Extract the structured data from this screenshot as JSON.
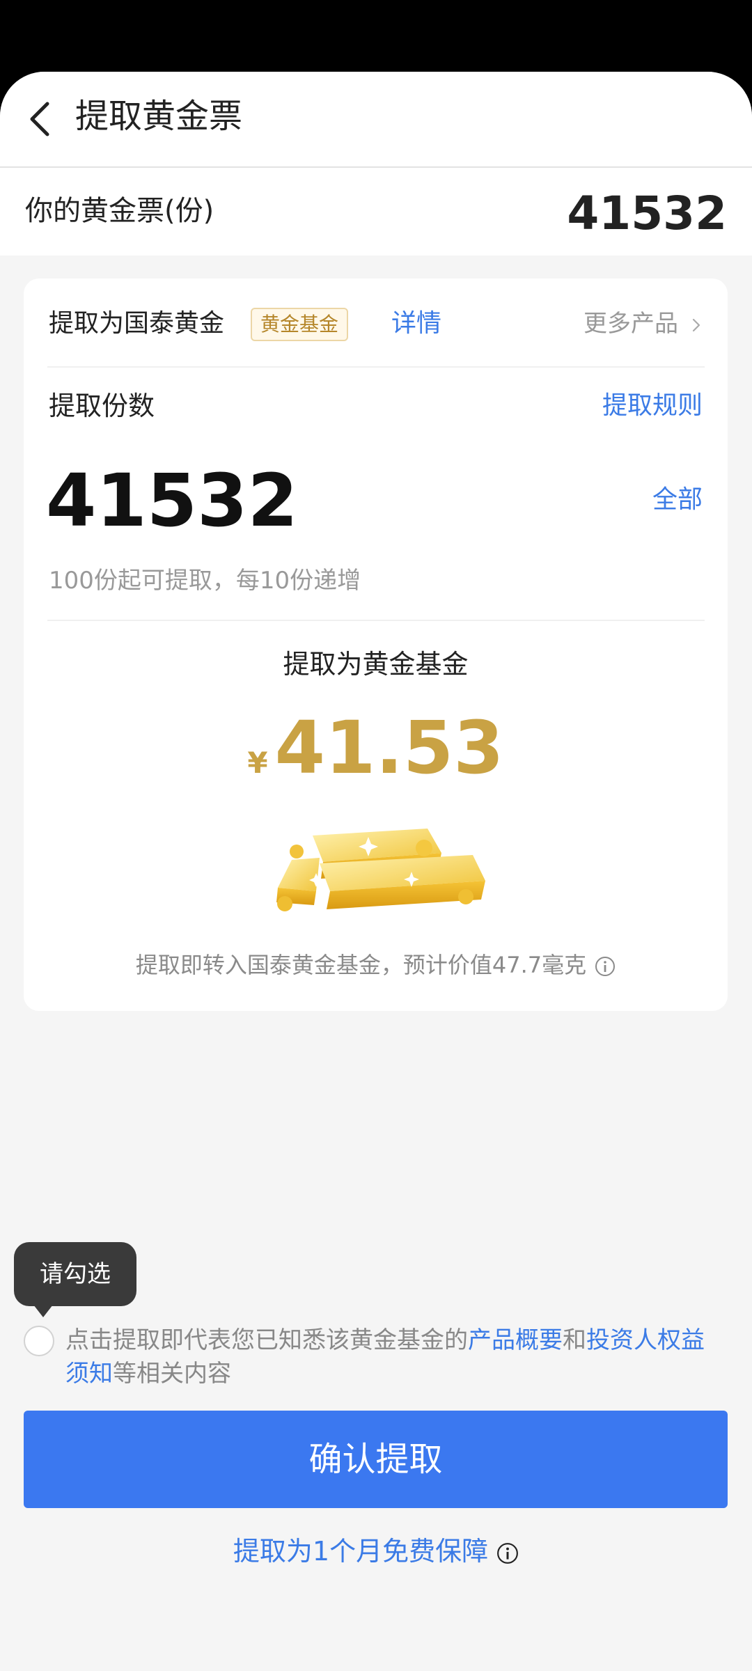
{
  "header": {
    "title": "提取黄金票",
    "back_icon": "chevron-left-icon"
  },
  "balance": {
    "label": "你的黄金票(份)",
    "value": "41532"
  },
  "product": {
    "prefix": "提取为国泰黄金",
    "badge": "黄金基金",
    "detail_link": "详情",
    "more_products": "更多产品"
  },
  "quantity": {
    "label": "提取份数",
    "rules_link": "提取规则",
    "value": "41532",
    "all_link": "全部",
    "hint": "100份起可提取，每10份递增"
  },
  "result": {
    "title": "提取为黄金基金",
    "currency": "¥",
    "amount": "41.53",
    "note": "提取即转入国泰黄金基金，预计价值47.7毫克",
    "illustration_icon": "gold-bars-icon"
  },
  "agreement": {
    "tooltip": "请勾选",
    "text_before": "点击提取即代表您已知悉该黄金基金的",
    "link1": "产品概要",
    "text_mid": "和",
    "link2": "投资人权益须知",
    "text_after": "等相关内容"
  },
  "actions": {
    "confirm": "确认提取",
    "free_protection": "提取为1个月免费保障"
  },
  "colors": {
    "accent_blue": "#3b78f0",
    "link_blue": "#3b7be6",
    "gold": "#c9a244"
  }
}
